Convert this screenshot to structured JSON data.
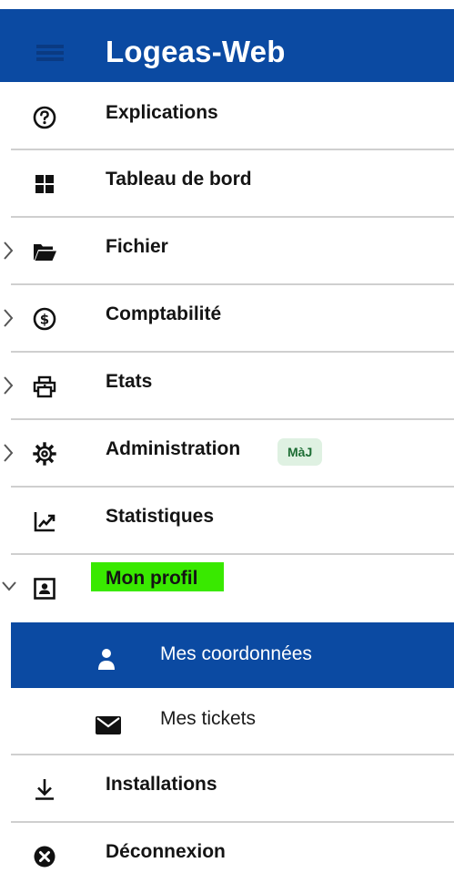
{
  "header": {
    "title": "Logeas-Web",
    "menu_icon": "hamburger-icon"
  },
  "menu": [
    {
      "label": "Explications",
      "icon": "help-circle-icon",
      "expandable": false
    },
    {
      "label": "Tableau de bord",
      "icon": "dashboard-icon",
      "expandable": false
    },
    {
      "label": "Fichier",
      "icon": "folder-open-icon",
      "expandable": true,
      "expanded": false
    },
    {
      "label": "Comptabilité",
      "icon": "dollar-circle-icon",
      "expandable": true,
      "expanded": false
    },
    {
      "label": "Etats",
      "icon": "printer-icon",
      "expandable": true,
      "expanded": false
    },
    {
      "label": "Administration",
      "icon": "gear-icon",
      "expandable": true,
      "expanded": false,
      "badge": "MàJ"
    },
    {
      "label": "Statistiques",
      "icon": "trending-up-icon",
      "expandable": false
    },
    {
      "label": "Mon profil",
      "icon": "profile-card-icon",
      "expandable": true,
      "expanded": true,
      "highlighted": true
    },
    {
      "label": "Installations",
      "icon": "download-icon",
      "expandable": false
    },
    {
      "label": "Déconnexion",
      "icon": "close-circle-icon",
      "expandable": false
    }
  ],
  "submenu": [
    {
      "label": "Mes coordonnées",
      "icon": "person-icon",
      "active": true
    },
    {
      "label": "Mes tickets",
      "icon": "envelope-icon",
      "active": false
    }
  ],
  "colors": {
    "header_bg": "#0b4aa2",
    "active_bg": "#0b4aa2",
    "highlight": "#39e900",
    "badge_bg": "#dff1e2",
    "badge_text": "#1d6d34",
    "divider": "#cfcfcf"
  }
}
